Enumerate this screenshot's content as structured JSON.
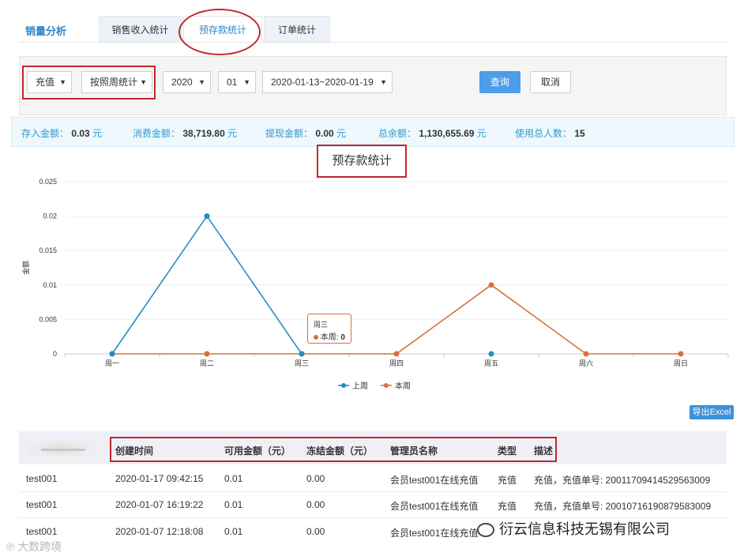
{
  "tabs": {
    "brand": "销量分析",
    "items": [
      {
        "label": "销售收入统计"
      },
      {
        "label": "预存款统计"
      },
      {
        "label": "订单统计"
      }
    ]
  },
  "filters": {
    "type": "充值",
    "period": "按照周统计",
    "year": "2020",
    "month": "01",
    "week": "2020-01-13~2020-01-19",
    "query_label": "查询",
    "cancel_label": "取消"
  },
  "stats": {
    "deposit_label": "存入金额：",
    "deposit_value": "0.03",
    "consume_label": "消费金额：",
    "consume_value": "38,719.80",
    "withdraw_label": "提现金额：",
    "withdraw_value": "0.00",
    "balance_label": "总余额：",
    "balance_value": "1,130,655.69",
    "users_label": "使用总人数：",
    "users_value": "15",
    "unit": "元"
  },
  "chart_data": {
    "type": "line",
    "title": "预存款统计",
    "ylabel": "金额",
    "xlabel": "",
    "categories": [
      "周一",
      "周二",
      "周三",
      "周四",
      "周五",
      "周六",
      "周日"
    ],
    "ylim": [
      0,
      0.025
    ],
    "yticks": [
      "0",
      "0.005",
      "0.01",
      "0.015",
      "0.02",
      "0.025"
    ],
    "series": [
      {
        "name": "上周",
        "color": "#1f90c1",
        "values": [
          0,
          0.02,
          0,
          null,
          0,
          null,
          null
        ]
      },
      {
        "name": "本周",
        "color": "#d9703c",
        "values": [
          0,
          0,
          0,
          0,
          0.01,
          0,
          0
        ]
      }
    ],
    "tooltip": {
      "category": "周三",
      "series": "本周",
      "value": "0"
    },
    "legend_position": "bottom"
  },
  "export_label": "导出Excel",
  "table": {
    "headers": [
      "创建时间",
      "可用金额（元）",
      "冻结金额（元）",
      "管理员名称",
      "类型",
      "描述"
    ],
    "rows": [
      [
        "test001",
        "2020-01-17 09:42:15",
        "0.01",
        "0.00",
        "会员test001在线充值",
        "充值",
        "充值，充值单号: 20011709414529563009"
      ],
      [
        "test001",
        "2020-01-07 16:19:22",
        "0.01",
        "0.00",
        "会员test001在线充值",
        "充值",
        "充值，充值单号: 20010716190879583009"
      ],
      [
        "test001",
        "2020-01-07 12:18:08",
        "0.01",
        "0.00",
        "会员test001在线充值",
        "",
        ""
      ]
    ]
  },
  "watermarks": {
    "company": "衍云信息科技无锡有限公司",
    "corner": "大数跨境"
  }
}
